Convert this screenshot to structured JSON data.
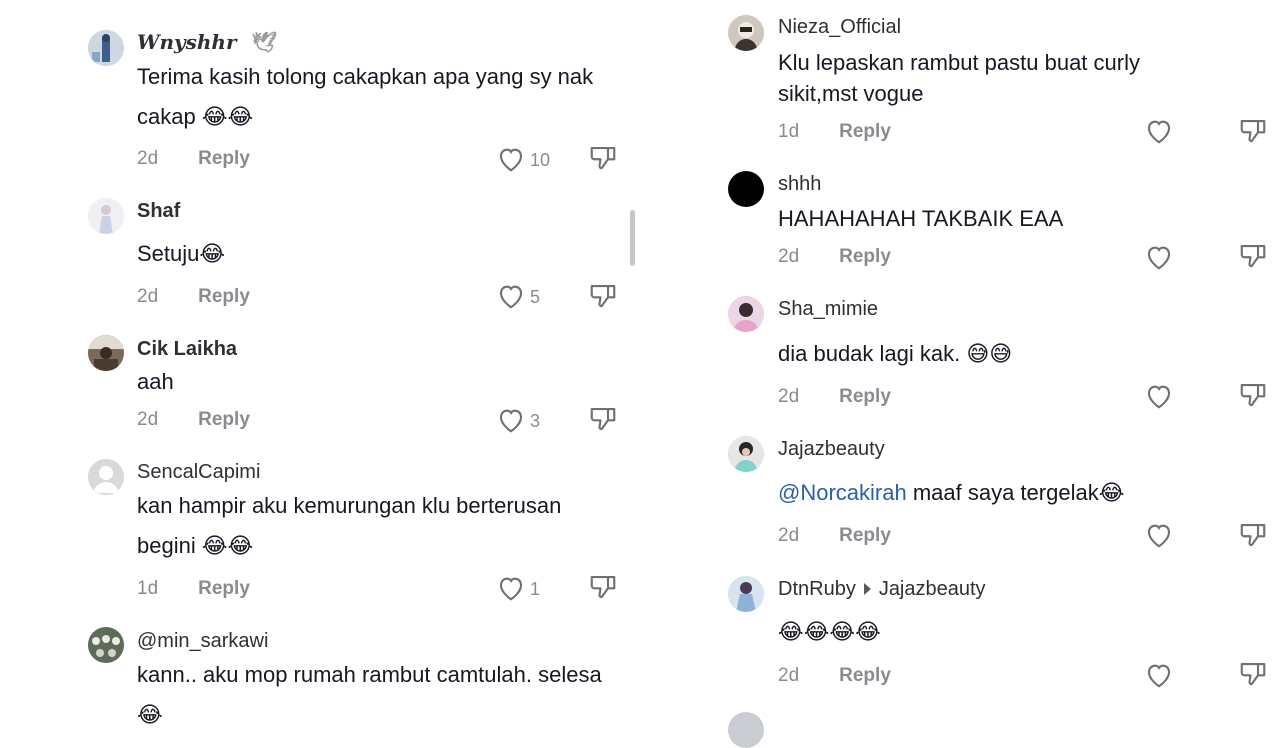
{
  "left_comments": [
    {
      "name": "Wnyshhr",
      "name_suffix": "🕊",
      "text": "Terima kasih tolong cakapkan apa yang sy nak cakap 😂😂",
      "time": "2d",
      "reply": "Reply",
      "likes": "10"
    },
    {
      "name": "Shaf",
      "text": "Setuju😂",
      "time": "2d",
      "reply": "Reply",
      "likes": "5"
    },
    {
      "name": "Cik Laikha",
      "text": "aah",
      "time": "2d",
      "reply": "Reply",
      "likes": "3"
    },
    {
      "name": "SencalCapimi",
      "text": "kan hampir aku kemurungan klu berterusan begini 😂😂",
      "time": "1d",
      "reply": "Reply",
      "likes": "1"
    },
    {
      "name": "@min_sarkawi",
      "text": "kann.. aku mop rumah rambut camtulah. selesa 😂"
    }
  ],
  "right_comments": [
    {
      "name": "Nieza_Official",
      "text": "Klu lepaskan rambut pastu buat curly sikit,mst vogue",
      "time": "1d",
      "reply": "Reply"
    },
    {
      "name": "shhh",
      "text": "HAHAHAHAH TAKBAIK EAA",
      "time": "2d",
      "reply": "Reply"
    },
    {
      "name": "Sha_mimie",
      "text": "dia budak lagi kak. 😅😅",
      "time": "2d",
      "reply": "Reply"
    },
    {
      "name": "Jajazbeauty",
      "mention": "@Norcakirah",
      "text": " maaf saya tergelak😂",
      "time": "2d",
      "reply": "Reply"
    },
    {
      "name": "DtnRuby",
      "reply_to": "Jajazbeauty",
      "text": "😂😂😂😂",
      "time": "2d",
      "reply": "Reply"
    }
  ]
}
